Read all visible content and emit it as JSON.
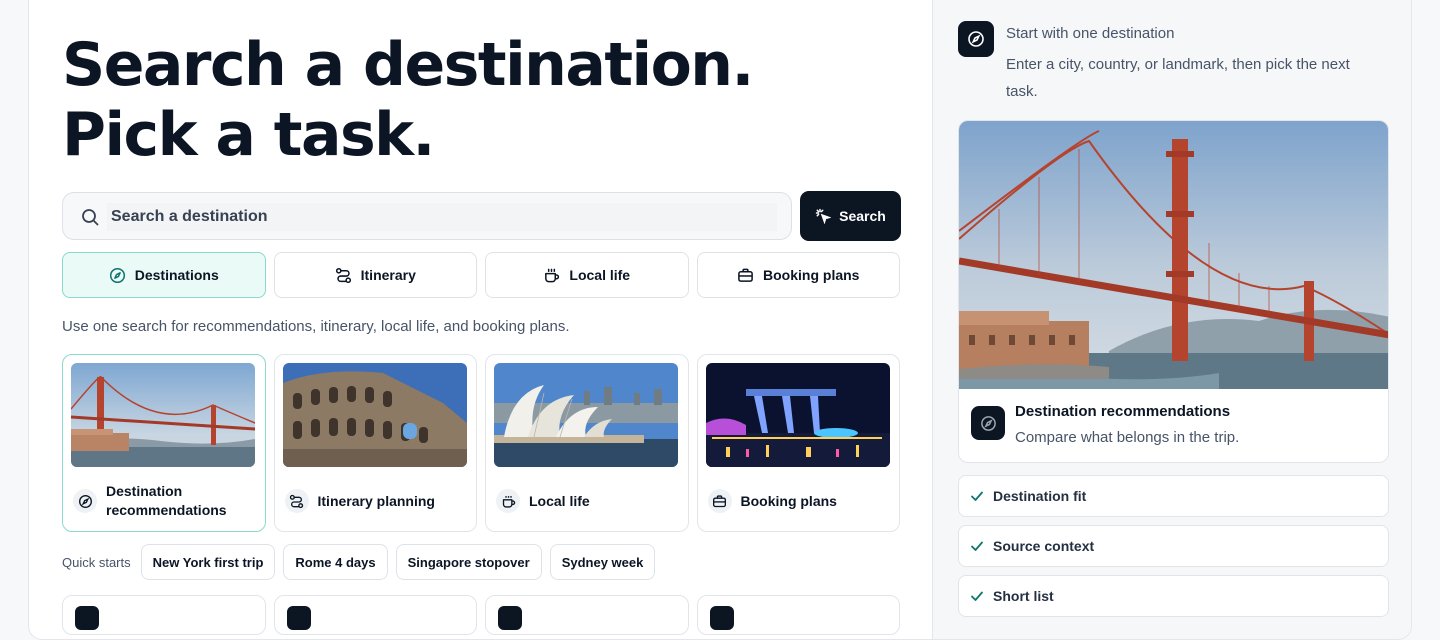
{
  "hero": {
    "line1": "Search a destination.",
    "line2": "Pick a task."
  },
  "search": {
    "placeholder": "Search a destination",
    "button_label": "Search"
  },
  "tabs": [
    {
      "label": "Destinations",
      "icon": "compass-icon",
      "active": true
    },
    {
      "label": "Itinerary",
      "icon": "route-icon",
      "active": false
    },
    {
      "label": "Local life",
      "icon": "coffee-cup-icon",
      "active": false
    },
    {
      "label": "Booking plans",
      "icon": "briefcase-icon",
      "active": false
    }
  ],
  "helper_text": "Use one search for recommendations, itinerary, local life, and booking plans.",
  "cards": [
    {
      "label": "Destination recommendations",
      "image": "golden-gate-bridge",
      "icon": "compass-icon",
      "active": true
    },
    {
      "label": "Itinerary planning",
      "image": "colosseum",
      "icon": "route-icon",
      "active": false
    },
    {
      "label": "Local life",
      "image": "sydney-opera-house",
      "icon": "coffee-cup-icon",
      "active": false
    },
    {
      "label": "Booking plans",
      "image": "marina-bay-sands",
      "icon": "briefcase-icon",
      "active": false
    }
  ],
  "quick_starts": {
    "label": "Quick starts",
    "chips": [
      "New York first trip",
      "Rome 4 days",
      "Singapore stopover",
      "Sydney week"
    ]
  },
  "aside": {
    "eyebrow": "Start with one destination",
    "description": "Enter a city, country, or landmark, then pick the next task.",
    "feature": {
      "image": "golden-gate-bridge",
      "title": "Destination recommendations",
      "subtitle": "Compare what belongs in the trip."
    },
    "checklist": [
      "Destination fit",
      "Source context",
      "Short list"
    ]
  },
  "colors": {
    "primary_dark": "#0c1522",
    "active_tint": "#eafaf6",
    "active_border": "#8ad9c9",
    "check_accent": "#0f766e"
  }
}
